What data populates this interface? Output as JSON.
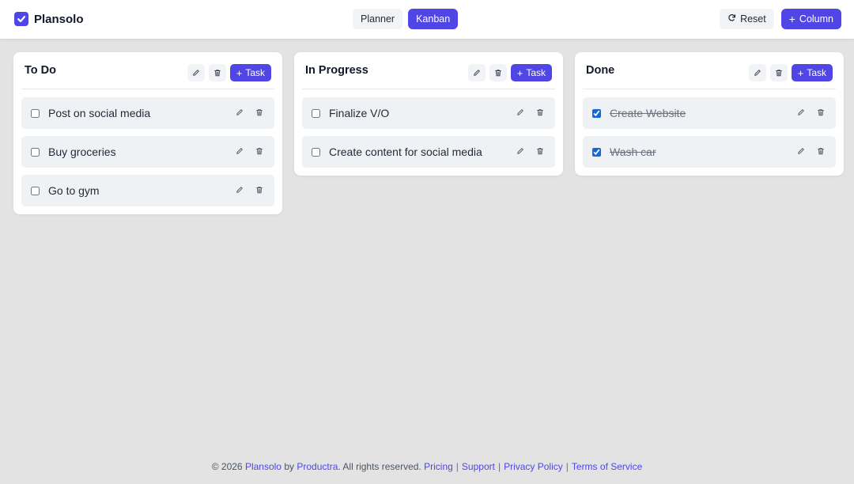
{
  "app": {
    "name": "Plansolo"
  },
  "view_toggle": {
    "planner": "Planner",
    "kanban": "Kanban",
    "active": "kanban"
  },
  "header_actions": {
    "reset": "Reset",
    "add_column": "Column"
  },
  "columns": [
    {
      "title": "To Do",
      "add_task": "Task",
      "tasks": [
        {
          "label": "Post on social media",
          "done": false
        },
        {
          "label": "Buy groceries",
          "done": false
        },
        {
          "label": "Go to gym",
          "done": false
        }
      ]
    },
    {
      "title": "In Progress",
      "add_task": "Task",
      "tasks": [
        {
          "label": "Finalize V/O",
          "done": false
        },
        {
          "label": "Create content for social media",
          "done": false
        }
      ]
    },
    {
      "title": "Done",
      "add_task": "Task",
      "tasks": [
        {
          "label": "Create Website",
          "done": true
        },
        {
          "label": "Wash car",
          "done": true
        }
      ]
    }
  ],
  "footer": {
    "prefix": "© 2026",
    "brand": "Plansolo",
    "by": "by",
    "company": "Productra",
    "rights": ". All rights reserved.",
    "links": [
      "Pricing",
      "Support",
      "Privacy Policy",
      "Terms of Service"
    ]
  },
  "colors": {
    "primary": "#4f46e5",
    "background": "#e3e3e3",
    "task_bg": "#eff2f5"
  },
  "icons": [
    "check-logo-icon",
    "refresh-icon",
    "plus-icon",
    "pencil-icon",
    "trash-icon"
  ]
}
